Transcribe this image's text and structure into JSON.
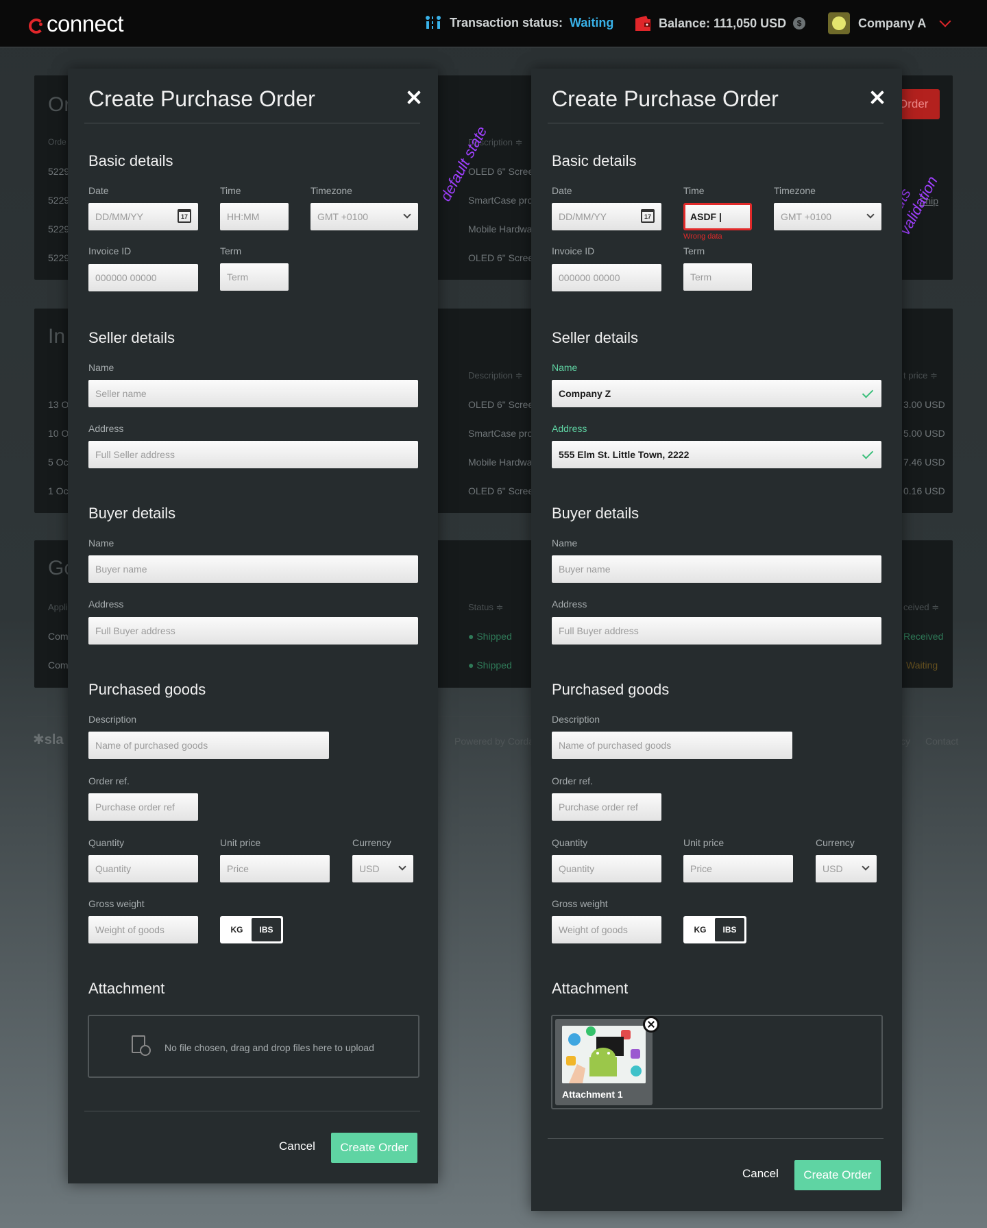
{
  "header": {
    "logo": "connect",
    "tx_label": "Transaction status:",
    "tx_status": "Waiting",
    "balance": "Balance: 111,050 USD",
    "company": "Company A",
    "accent": "#39b2e9",
    "brand": "#e0262a"
  },
  "background": {
    "orders_title": "Or",
    "order_btn": "Order",
    "ordercol": "Orde",
    "desc_head": "Description ≑",
    "desc_head2": "Description ≑",
    "rows": [
      "OLED 6\" Scree",
      "SmartCase pro",
      "Mobile Hardwa",
      "OLED 6\" Scree"
    ],
    "ids": [
      "5229",
      "5229",
      "5229",
      "5229"
    ],
    "ship": "Ship",
    "inv_title": "In",
    "inv_dates": [
      "13 O",
      "10 O",
      "5 Oc",
      "1 Oc"
    ],
    "prices": [
      "3.00 USD",
      "5.00 USD",
      "7.46 USD",
      "0.16 USD"
    ],
    "price_head": "t price ≑",
    "goods_title": "Go",
    "appli": "Appli",
    "status_head": "Status ≑",
    "received_head": "ceived ≑",
    "com": [
      "Com",
      "Com"
    ],
    "shipped": [
      "● Shipped",
      "● Shipped"
    ],
    "recv": [
      "Received",
      "Waiting"
    ],
    "footer_left": "sla",
    "powered": "Powered by Corda",
    "footer_cy": "cy",
    "contact": "Contact"
  },
  "annotations": {
    "left": "default state",
    "right": "inputs validation"
  },
  "modal_left": {
    "title": "Create Purchase Order",
    "basic": "Basic details",
    "date_lbl": "Date",
    "date_ph": "DD/MM/YY",
    "time_lbl": "Time",
    "time_ph": "HH:MM",
    "tz_lbl": "Timezone",
    "tz_val": "GMT +0100",
    "inv_lbl": "Invoice ID",
    "inv_ph": "000000 00000",
    "term_lbl": "Term",
    "term_ph": "Term",
    "seller": "Seller details",
    "s_name_lbl": "Name",
    "s_name_ph": "Seller name",
    "s_addr_lbl": "Address",
    "s_addr_ph": "Full Seller address",
    "buyer": "Buyer details",
    "b_name_lbl": "Name",
    "b_name_ph": "Buyer name",
    "b_addr_lbl": "Address",
    "b_addr_ph": "Full Buyer address",
    "goods": "Purchased goods",
    "desc_lbl": "Description",
    "desc_ph": "Name of purchased goods",
    "ref_lbl": "Order ref.",
    "ref_ph": "Purchase order ref",
    "qty_lbl": "Quantity",
    "qty_ph": "Quantity",
    "price_lbl": "Unit price",
    "price_ph": "Price",
    "cur_lbl": "Currency",
    "cur_val": "USD",
    "wt_lbl": "Gross weight",
    "wt_ph": "Weight of goods",
    "kg": "KG",
    "ibs": "IBS",
    "attach": "Attachment",
    "drop_txt": "No file chosen, drag and drop files here to upload",
    "cancel": "Cancel",
    "create": "Create Order"
  },
  "modal_right": {
    "title": "Create Purchase Order",
    "basic": "Basic details",
    "date_lbl": "Date",
    "date_ph": "DD/MM/YY",
    "time_lbl": "Time",
    "time_val": "ASDF |",
    "time_err": "Wrong data",
    "tz_lbl": "Timezone",
    "tz_val": "GMT +0100",
    "inv_lbl": "Invoice ID",
    "inv_ph": "000000 00000",
    "term_lbl": "Term",
    "term_ph": "Term",
    "seller": "Seller details",
    "s_name_lbl": "Name",
    "s_name_val": "Company Z",
    "s_addr_lbl": "Address",
    "s_addr_val": "555 Elm St. Little Town, 2222",
    "buyer": "Buyer details",
    "b_name_lbl": "Name",
    "b_name_ph": "Buyer name",
    "b_addr_lbl": "Address",
    "b_addr_ph": "Full Buyer address",
    "goods": "Purchased goods",
    "desc_lbl": "Description",
    "desc_ph": "Name of purchased goods",
    "ref_lbl": "Order ref.",
    "ref_ph": "Purchase order ref",
    "qty_lbl": "Quantity",
    "qty_ph": "Quantity",
    "price_lbl": "Unit price",
    "price_ph": "Price",
    "cur_lbl": "Currency",
    "cur_val": "USD",
    "wt_lbl": "Gross weight",
    "wt_ph": "Weight of goods",
    "kg": "KG",
    "ibs": "IBS",
    "attach": "Attachment",
    "file_name": "Attachment 1",
    "cancel": "Cancel",
    "create": "Create Order"
  }
}
